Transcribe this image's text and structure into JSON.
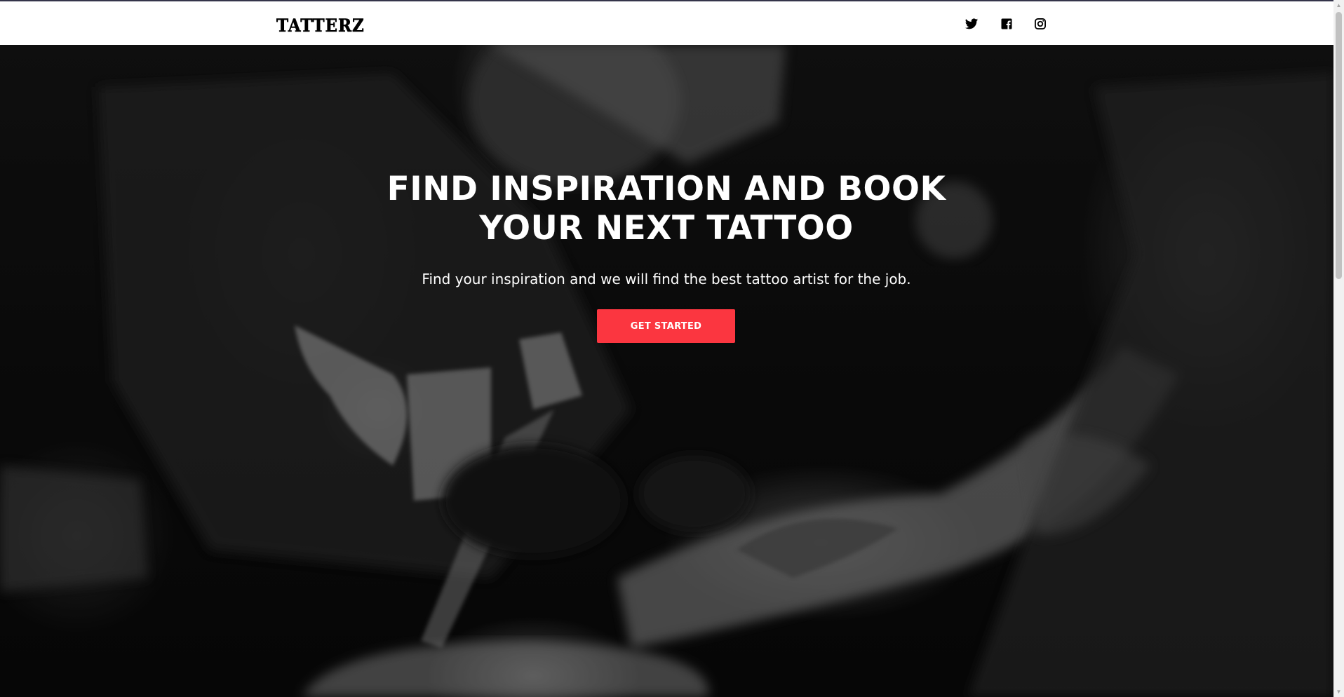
{
  "brand": {
    "logo_text": "TATTERZ"
  },
  "nav": {
    "social": [
      {
        "name": "twitter",
        "icon": "twitter-icon"
      },
      {
        "name": "facebook",
        "icon": "facebook-icon"
      },
      {
        "name": "instagram",
        "icon": "instagram-icon"
      }
    ]
  },
  "hero": {
    "title_line1": "FIND INSPIRATION AND BOOK",
    "title_line2": "YOUR NEXT TATTOO",
    "subtitle": "Find your inspiration and we will find the best tattoo artist for the job.",
    "cta_label": "GET STARTED",
    "background_image": "grayscale photo of tattoo artist tattooing a forearm"
  },
  "colors": {
    "accent": "#fb3640",
    "nav_background": "#ffffff",
    "hero_text": "#ffffff"
  }
}
